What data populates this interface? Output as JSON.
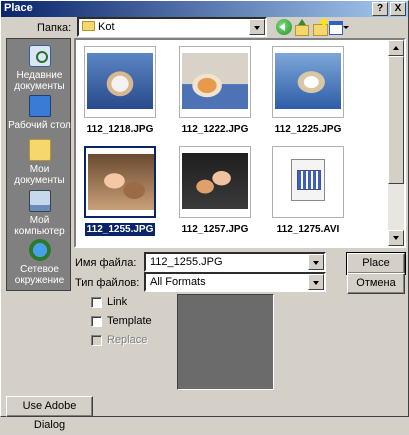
{
  "window": {
    "title": "Place",
    "help_glyph": "?",
    "close_glyph": "X"
  },
  "location": {
    "label": "Папка:",
    "value": "Kot"
  },
  "places": [
    {
      "label": "Недавние документы",
      "icon": "recent-documents-icon"
    },
    {
      "label": "Рабочий стол",
      "icon": "desktop-icon"
    },
    {
      "label": "Мои документы",
      "icon": "my-documents-icon"
    },
    {
      "label": "Мой компьютер",
      "icon": "my-computer-icon"
    },
    {
      "label": "Сетевое окружение",
      "icon": "network-icon"
    }
  ],
  "files": [
    {
      "name": "112_1218.JPG",
      "selected": false
    },
    {
      "name": "112_1222.JPG",
      "selected": false
    },
    {
      "name": "112_1225.JPG",
      "selected": false
    },
    {
      "name": "112_1255.JPG",
      "selected": true
    },
    {
      "name": "112_1257.JPG",
      "selected": false
    },
    {
      "name": "112_1275.AVI",
      "selected": false
    }
  ],
  "filename": {
    "label": "Имя файла:",
    "value": "112_1255.JPG"
  },
  "filetype": {
    "label": "Тип файлов:",
    "value": "All Formats"
  },
  "buttons": {
    "place": "Place",
    "cancel": "Отмена",
    "adobe_dialog": "Use Adobe Dialog"
  },
  "options": {
    "link": {
      "label": "Link",
      "checked": false,
      "enabled": true
    },
    "template": {
      "label": "Template",
      "checked": false,
      "enabled": true
    },
    "replace": {
      "label": "Replace",
      "checked": false,
      "enabled": false
    }
  },
  "colors": {
    "selection": "#0a246a",
    "dialog_bg": "#d4d0c8",
    "preview_bg": "#6b6b6b"
  }
}
